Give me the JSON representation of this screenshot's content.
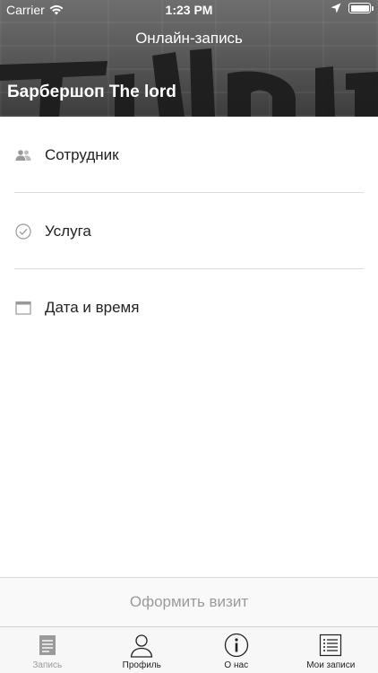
{
  "status_bar": {
    "carrier": "Carrier",
    "time": "1:23 PM"
  },
  "header": {
    "nav_title": "Онлайн-запись",
    "shop_name": "Барбершоп The lord"
  },
  "rows": [
    {
      "label": "Сотрудник",
      "icon": "people-icon"
    },
    {
      "label": "Услуга",
      "icon": "checkmark-circle-icon"
    },
    {
      "label": "Дата и время",
      "icon": "calendar-icon"
    }
  ],
  "submit_label": "Оформить визит",
  "tabs": [
    {
      "label": "Запись",
      "icon": "document-icon",
      "active": true
    },
    {
      "label": "Профиль",
      "icon": "user-icon",
      "active": false
    },
    {
      "label": "О нас",
      "icon": "info-icon",
      "active": false
    },
    {
      "label": "Мои записи",
      "icon": "list-icon",
      "active": false
    }
  ],
  "colors": {
    "submit_text": "#9a9a9a",
    "active_tab": "#9a9a9a",
    "separator": "#dcdcdc"
  }
}
